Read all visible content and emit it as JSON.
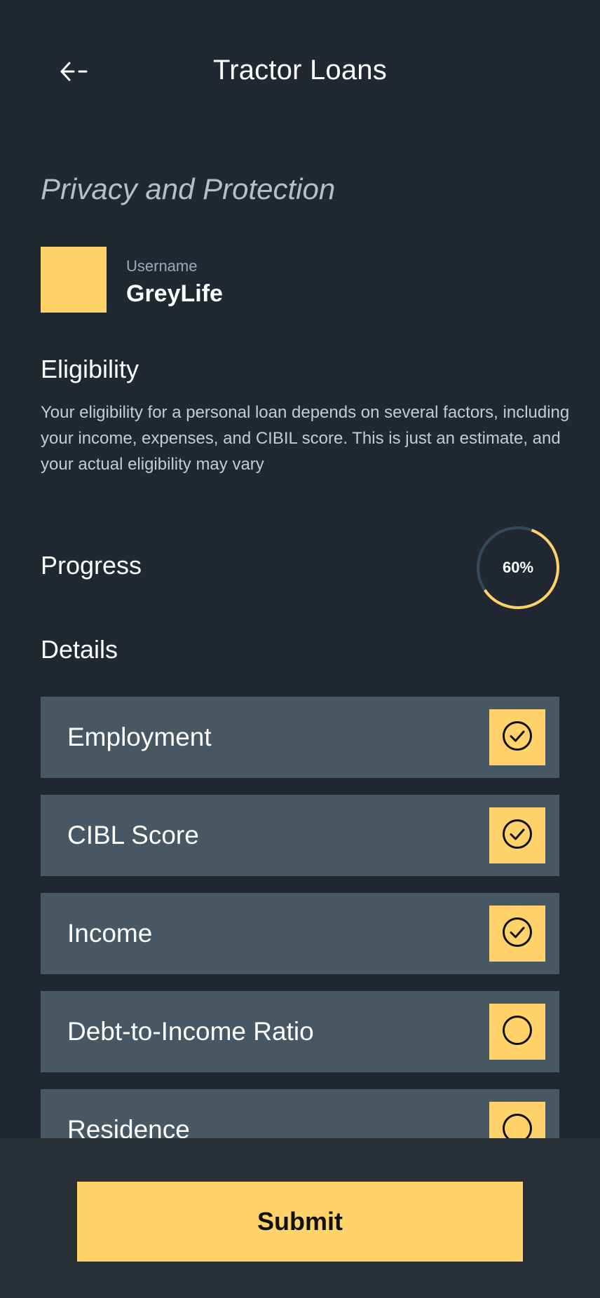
{
  "header": {
    "title": "Tractor Loans",
    "back_icon": "back-arrow-icon"
  },
  "privacy": {
    "title": "Privacy and Protection"
  },
  "user": {
    "username_label": "Username",
    "username": "GreyLife",
    "avatar_color": "#ffd369"
  },
  "eligibility": {
    "heading": "Eligibility",
    "description": "Your eligibility for a personal loan depends on several factors, including your income, expenses, and CIBIL score. This is just an estimate, and your actual eligibility may vary"
  },
  "progress": {
    "heading": "Progress",
    "value_text": "60%",
    "value": 0.6
  },
  "details": {
    "heading": "Details",
    "items": [
      {
        "label": "Employment",
        "checked": true,
        "icon": "check-circle-icon"
      },
      {
        "label": "CIBL Score",
        "checked": true,
        "icon": "check-circle-icon"
      },
      {
        "label": "Income",
        "checked": true,
        "icon": "check-circle-icon"
      },
      {
        "label": "Debt-to-Income Ratio",
        "checked": false,
        "icon": "empty-circle-icon"
      },
      {
        "label": "Residence",
        "checked": false,
        "icon": "empty-circle-icon"
      }
    ]
  },
  "footer": {
    "submit_label": "Submit"
  },
  "colors": {
    "background": "#222831",
    "accent": "#ffd369",
    "card": "#475864",
    "footer": "#283036",
    "ring_track": "#34495a"
  }
}
